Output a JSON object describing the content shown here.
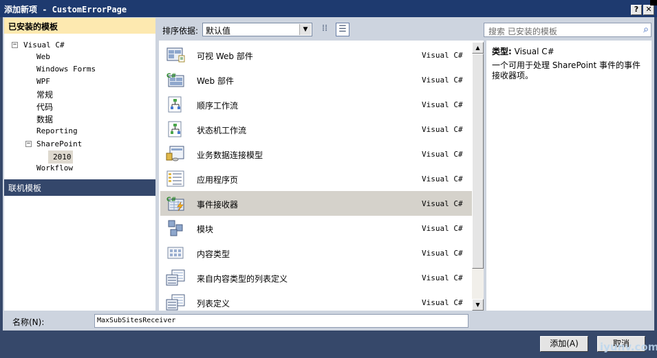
{
  "window": {
    "title": "添加新项 - CustomErrorPage",
    "help_button": "?",
    "close_button": "✕"
  },
  "left": {
    "installed_header": "已安装的模板",
    "tree": [
      {
        "label": "Visual C#",
        "indent": 0,
        "expander": "−"
      },
      {
        "label": "Web",
        "indent": 1
      },
      {
        "label": "Windows Forms",
        "indent": 1
      },
      {
        "label": "WPF",
        "indent": 1
      },
      {
        "label": "常规",
        "indent": 1
      },
      {
        "label": "代码",
        "indent": 1
      },
      {
        "label": "数据",
        "indent": 1
      },
      {
        "label": "Reporting",
        "indent": 1
      },
      {
        "label": "SharePoint",
        "indent": 1,
        "expander": "−"
      },
      {
        "label": "2010",
        "indent": 2,
        "selected": true
      },
      {
        "label": "Workflow",
        "indent": 1
      }
    ],
    "online_templates": "联机模板"
  },
  "toolbar": {
    "sort_label": "排序依据:",
    "sort_value": "默认值",
    "view_small_icon": "small-icons-view-icon",
    "view_details_icon": "details-view-icon",
    "search_placeholder": "搜索 已安装的模板"
  },
  "templates": [
    {
      "name": "可视 Web 部件",
      "lang": "Visual C#",
      "icon": "visual-web-part-icon"
    },
    {
      "name": "Web 部件",
      "lang": "Visual C#",
      "icon": "web-part-icon"
    },
    {
      "name": "顺序工作流",
      "lang": "Visual C#",
      "icon": "sequential-workflow-icon"
    },
    {
      "name": "状态机工作流",
      "lang": "Visual C#",
      "icon": "state-machine-workflow-icon"
    },
    {
      "name": "业务数据连接模型",
      "lang": "Visual C#",
      "icon": "bdc-model-icon"
    },
    {
      "name": "应用程序页",
      "lang": "Visual C#",
      "icon": "application-page-icon"
    },
    {
      "name": "事件接收器",
      "lang": "Visual C#",
      "icon": "event-receiver-icon",
      "selected": true
    },
    {
      "name": "模块",
      "lang": "Visual C#",
      "icon": "module-icon"
    },
    {
      "name": "内容类型",
      "lang": "Visual C#",
      "icon": "content-type-icon"
    },
    {
      "name": "来自内容类型的列表定义",
      "lang": "Visual C#",
      "icon": "list-definition-from-content-type-icon"
    },
    {
      "name": "列表定义",
      "lang": "Visual C#",
      "icon": "list-definition-icon"
    }
  ],
  "details": {
    "type_label": "类型:",
    "type_value": "Visual C#",
    "description": "一个可用于处理 SharePoint 事件的事件接收器项。"
  },
  "bottom": {
    "name_label": "名称(N):",
    "name_value": "MaxSubSitesReceiver",
    "add_button": "添加(A)",
    "cancel_button": "取消"
  },
  "watermark": "iyunv.com"
}
